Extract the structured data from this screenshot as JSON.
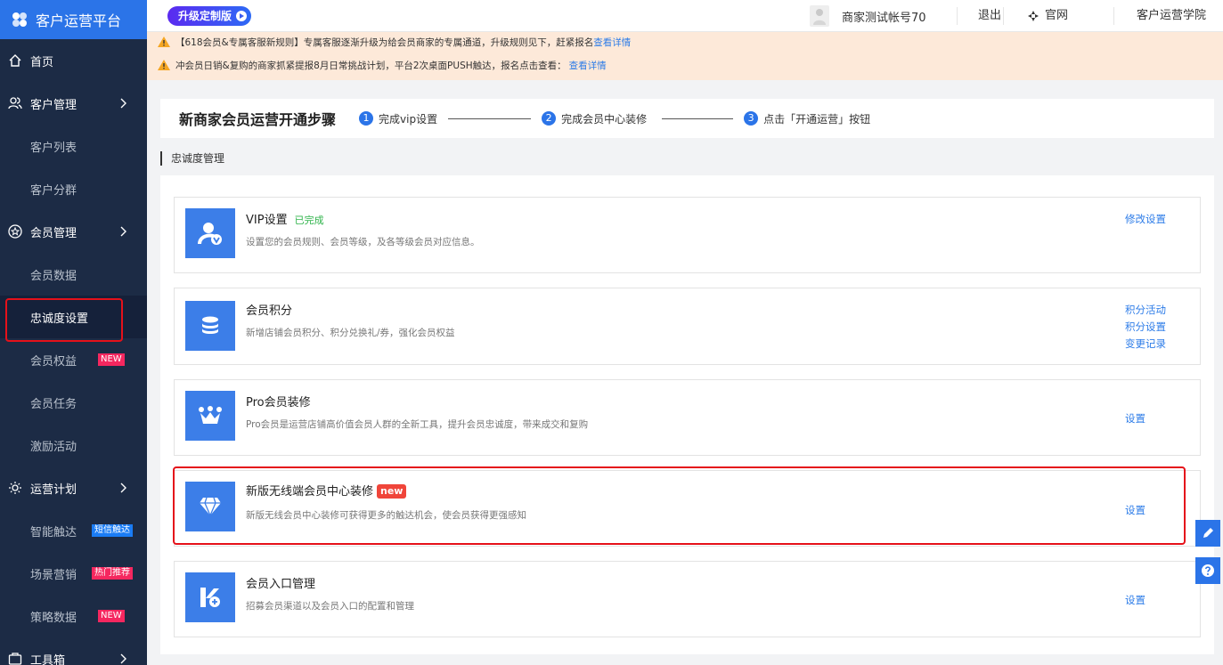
{
  "sidebar": {
    "logo": "客户运营平台",
    "items": [
      {
        "label": "首页"
      },
      {
        "label": "客户管理"
      },
      {
        "label": "客户列表"
      },
      {
        "label": "客户分群"
      },
      {
        "label": "会员管理"
      },
      {
        "label": "会员数据"
      },
      {
        "label": "忠诚度设置"
      },
      {
        "label": "会员权益",
        "badge": "NEW"
      },
      {
        "label": "会员任务"
      },
      {
        "label": "激励活动"
      },
      {
        "label": "运营计划"
      },
      {
        "label": "智能触达",
        "badge": "短信触达"
      },
      {
        "label": "场景营销",
        "badge": "热门推荐"
      },
      {
        "label": "策略数据",
        "badge": "NEW"
      },
      {
        "label": "工具箱"
      }
    ]
  },
  "header": {
    "upgrade_label": "升级定制版",
    "account": "商家测试帐号70",
    "logout": "退出",
    "official_site": "官网",
    "academy": "客户运营学院"
  },
  "notices": [
    {
      "text": "【618会员&专属客服新规则】专属客服逐渐升级为给会员商家的专属通道，升级规则见下，赶紧报名",
      "link": "查看详情"
    },
    {
      "text": "冲会员日销&复购的商家抓紧提报8月日常挑战计划，平台2次桌面PUSH触达，报名点击查看：",
      "link": "查看详情"
    }
  ],
  "steps": {
    "title": "新商家会员运营开通步骤",
    "items": [
      {
        "num": "1",
        "label": "完成vip设置"
      },
      {
        "num": "2",
        "label": "完成会员中心装修"
      },
      {
        "num": "3",
        "label": "点击「开通运营」按钮"
      }
    ]
  },
  "section_title": "忠诚度管理",
  "cards": [
    {
      "title": "VIP设置",
      "tag": "已完成",
      "desc": "设置您的会员规则、会员等级，及各等级会员对应信息。",
      "actions": [
        "修改设置"
      ],
      "icon": "user-vip-icon"
    },
    {
      "title": "会员积分",
      "desc": "新增店铺会员积分、积分兑换礼/券，强化会员权益",
      "actions": [
        "积分活动",
        "积分设置",
        "变更记录"
      ],
      "icon": "database-icon"
    },
    {
      "title": "Pro会员装修",
      "desc": "Pro会员是运营店铺高价值会员人群的全新工具，提升会员忠诚度，带来成交和复购",
      "actions": [
        "设置"
      ],
      "icon": "crown-icon"
    },
    {
      "title": "新版无线端会员中心装修",
      "tag": "new",
      "desc": "新版无线会员中心装修可获得更多的触达机会，使会员获得更强感知",
      "actions": [
        "设置"
      ],
      "icon": "diamond-icon"
    },
    {
      "title": "会员入口管理",
      "desc": "招募会员渠道以及会员入口的配置和管理",
      "actions": [
        "设置"
      ],
      "icon": "entry-icon"
    }
  ],
  "colors": {
    "sidebar_bg": "#1c2b45",
    "accent": "#2b74e8",
    "link": "#2d7ce8",
    "new_badge": "#f5275f",
    "highlight": "#e5111a"
  }
}
